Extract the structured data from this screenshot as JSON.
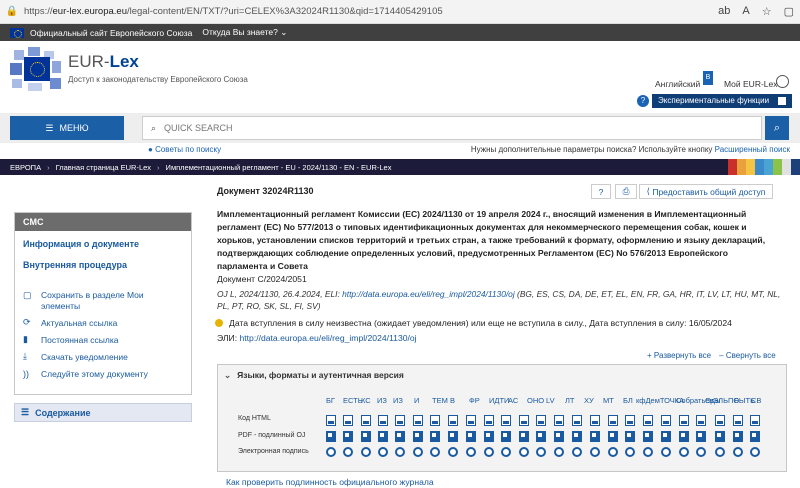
{
  "browser": {
    "url_prefix": "https://",
    "url_host": "eur-lex.europa.eu",
    "url_rest": "/legal-content/EN/TXT/?uri=CELEX%3A32024R1130&qid=1714405429105",
    "icons": [
      "translate-icon",
      "read-aloud-icon",
      "favorite-icon",
      "tab-icon"
    ]
  },
  "eu_bar": {
    "official": "Официальный сайт Европейского Союза",
    "question": "Откуда Вы знаете? ⌄"
  },
  "header": {
    "logo_eur": "EUR-",
    "logo_lex": "Lex",
    "subtitle": "Доступ к законодательству Европейского Союза",
    "language": "Английский",
    "language_badge": "В",
    "my_eurlex": "Мой EUR-Lex",
    "experimental_q": "?",
    "experimental": "Экспериментальные функции"
  },
  "search": {
    "menu_label": "МЕНЮ",
    "placeholder": "QUICK SEARCH",
    "tips": "Советы по поиску",
    "need_more": "Нужны дополнительные параметры поиска? Используйте кнопку ",
    "advanced": "Расширенный поиск"
  },
  "breadcrumb": [
    "ЕВРОПА",
    "Главная страница EUR-Lex",
    "Имплементационный регламент - EU - 2024/1130 - EN - EUR-Lex"
  ],
  "stripe_colors": [
    "#c9302c",
    "#e9a23b",
    "#f6c443",
    "#3a89c9",
    "#49a4d4",
    "#8bc34a",
    "#e1e1e1",
    "#1d3f7a"
  ],
  "left": {
    "cmc": "CMC",
    "doc_info": "Информация о документе",
    "procedure": "Внутренняя процедура",
    "actions": [
      {
        "icon": "save-icon",
        "label": "Сохранить в разделе Мои элементы"
      },
      {
        "icon": "link-refresh-icon",
        "label": "Актуальная ссылка"
      },
      {
        "icon": "bookmark-icon",
        "label": "Постоянная ссылка"
      },
      {
        "icon": "download-icon",
        "label": "Скачать уведомление"
      },
      {
        "icon": "rss-icon",
        "label": "Следуйте этому документу"
      }
    ],
    "contents": "Содержание"
  },
  "doc": {
    "number": "Документ 32024R1130",
    "share": "Предоставить общий доступ",
    "title": "Имплементационный регламент Комиссии (ЕС) 2024/1130 от 19 апреля 2024 г., вносящий изменения в Имплементационный регламент (ЕС) No 577/2013 о типовых идентификационных документах для некоммерческого перемещения собак, кошек и хорьков, установлении списков территорий и третьих стран, а также требований к формату, оформлению и языку деклараций, подтверждающих соблюдение определенных условий, предусмотренных Регламентом (ЕС) No 576/2013 Европейского парламента и Совета",
    "c_doc": "Документ C/2024/2051",
    "oj_prefix": "OJ L, 2024/1130, 26.4.2024, ELI: ",
    "oj_link": "http://data.europa.eu/eli/reg_impl/2024/1130/oj",
    "oj_langs": " (BG, ES, CS, DA, DE, ET, EL, EN, FR, GA, HR, IT, LV, LT, HU, MT, NL, PL, PT, RO, SK, SL, FI, SV)",
    "date_status": "Дата вступления в силу неизвестна (ожидает уведомления) или еще не вступила в силу., Дата вступления в силу: 16/05/2024",
    "eli_label": "ЭЛИ: ",
    "eli_link": "http://data.europa.eu/eli/reg_impl/2024/1130/oj",
    "expand_all": "+ Развернуть все",
    "collapse_all": "– Свернуть все",
    "langs_header": "Языки, форматы и аутентичная версия",
    "row_html": "Код HTML",
    "row_pdf": "PDF - подлинный OJ",
    "row_sig": "Электронная подпись",
    "lang_codes": [
      "БГ",
      "ЕСТЬ",
      "КС",
      "ИЗ",
      "ИЗ",
      "И",
      "ТЕМ",
      "В",
      "ФР",
      "ИДТИ",
      "АС",
      "ОНО",
      "LV",
      "ЛТ",
      "ХУ",
      "МТ",
      "БЛ",
      "кфДемТОЧКА",
      "Собратьев",
      "Оды",
      "ЭЛЬПО",
      "БЫТЬ",
      "СВ"
    ],
    "verify": "Как проверить подлинность официального журнала"
  }
}
